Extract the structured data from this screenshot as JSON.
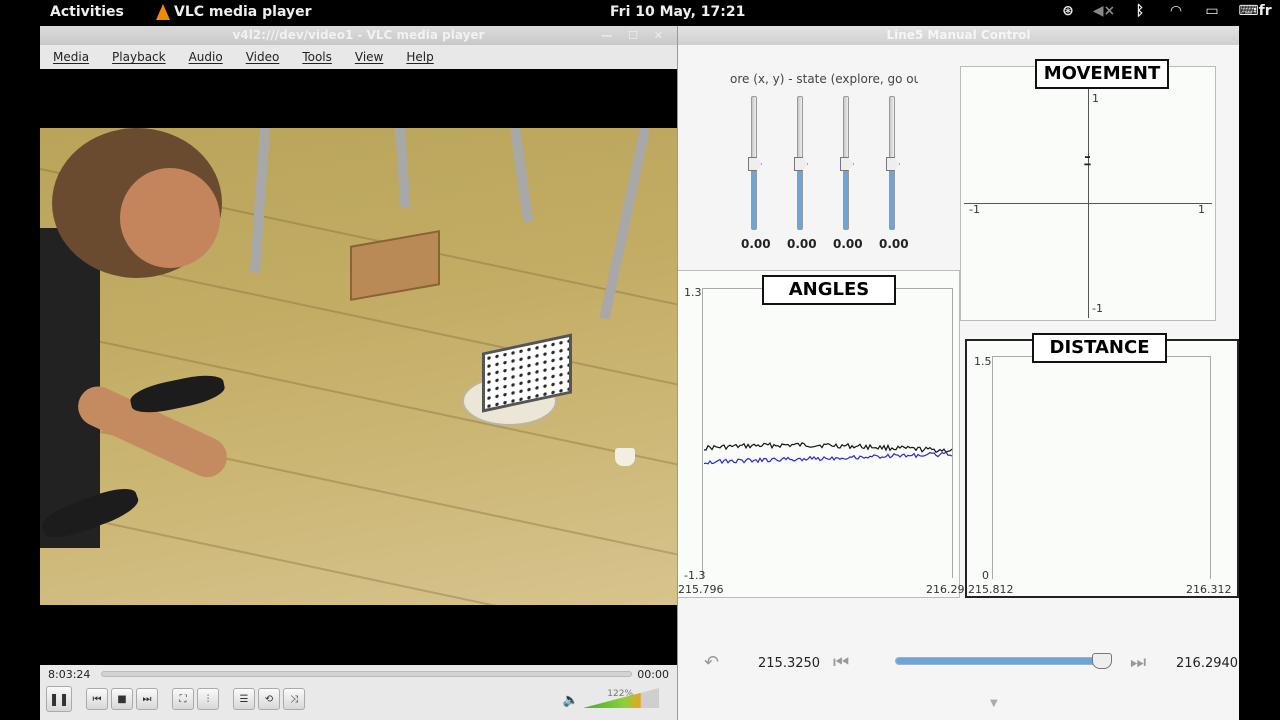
{
  "topbar": {
    "activities": "Activities",
    "app_name": "VLC media player",
    "clock": "Fri 10 May, 17:21",
    "tray_icons": [
      "accessibility-icon",
      "volume-muted-icon",
      "bluetooth-icon",
      "wifi-icon",
      "battery-icon",
      "keyboard-icon"
    ],
    "lang": "fr"
  },
  "vlc": {
    "title": "v4l2:///dev/video1 - VLC media player",
    "menu": [
      "Media",
      "Playback",
      "Audio",
      "Video",
      "Tools",
      "View",
      "Help"
    ],
    "time_elapsed": "8:03:24",
    "time_total": "00:00",
    "volume": "122%"
  },
  "line5": {
    "title": "Line5 Manual Control",
    "state_label": "ore (x, y) - state (explore, go outp",
    "slider_values": [
      "0.00",
      "0.00",
      "0.00",
      "0.00"
    ],
    "movement": {
      "title": "MOVEMENT",
      "top": "1",
      "bottom": "-1",
      "left": "-1",
      "right": "1"
    },
    "angles": {
      "title": "ANGLES",
      "ymax": "1.3",
      "ymin": "-1.3",
      "xmin": "215.796",
      "xmax": "216.29"
    },
    "distance": {
      "title": "DISTANCE",
      "ymax": "1.5",
      "ymin": "0",
      "xmin": "215.812",
      "xmax": "216.312"
    },
    "bottom": {
      "left_value": "215.3250",
      "right_value": "216.2940",
      "position_fraction": 0.93
    }
  },
  "colors": {
    "series_black": "#111111",
    "series_blue": "#2a2ac8",
    "slider_fill": "#6ea5d6"
  }
}
